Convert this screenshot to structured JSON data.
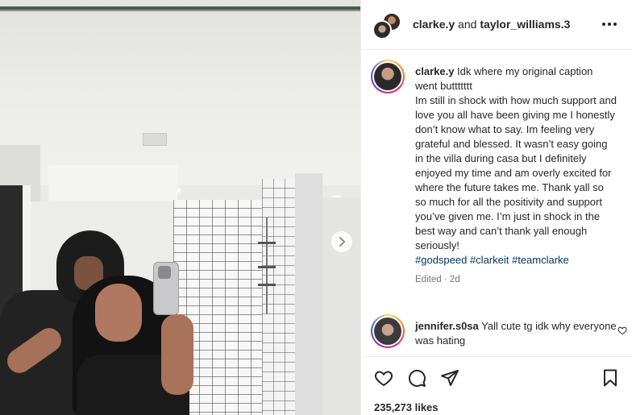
{
  "post": {
    "header": {
      "owner": "clarke.y",
      "joiner": " and ",
      "collaborator": "taylor_williams.3"
    },
    "caption": {
      "username": "clarke.y",
      "text_line1": " Idk where my original caption went buttttttt",
      "text_body": "Im still in shock with how much support and love you all have been giving me I honestly don’t know what to say. Im feeling very grateful and blessed. It wasn’t easy going in the villa during casa but I definitely enjoyed my time and am overly excited for where the future takes me. Thank yall so so much for all the positivity and support you’ve given me. I’m just in shock in the best way and can’t thank yall enough seriously!",
      "hashtags": "#godspeed #clarkeit #teamclarke",
      "meta": "Edited · 2d"
    },
    "comments": [
      {
        "username": "jennifer.s0sa",
        "text": " Yall cute tg idk why everyone was hating"
      }
    ],
    "likes": "235,273 likes"
  },
  "icons": {
    "more": "more-options-icon",
    "next": "chevron-right-icon",
    "like": "heart-icon",
    "comment": "comment-icon",
    "share": "send-icon",
    "save": "bookmark-icon"
  },
  "colors": {
    "text": "#262626",
    "hashtag": "#00376b",
    "muted": "#737373",
    "border": "#efefef"
  }
}
